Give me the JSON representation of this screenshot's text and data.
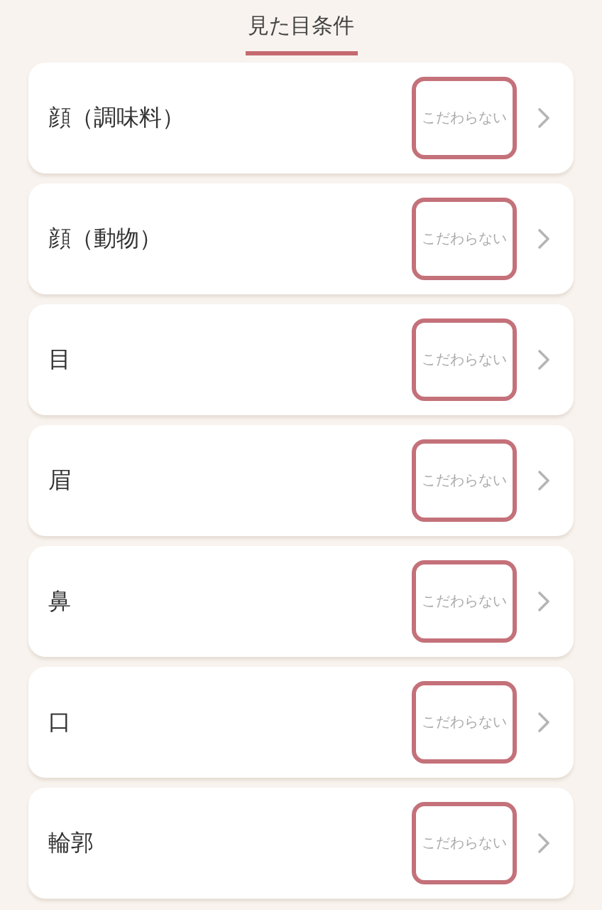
{
  "tabs": [
    {
      "label": "見た目条件",
      "selected": true
    }
  ],
  "conditions": [
    {
      "label": "顔（調味料）",
      "value": "こだわらない"
    },
    {
      "label": "顔（動物）",
      "value": "こだわらない"
    },
    {
      "label": "目",
      "value": "こだわらない"
    },
    {
      "label": "眉",
      "value": "こだわらない"
    },
    {
      "label": "鼻",
      "value": "こだわらない"
    },
    {
      "label": "口",
      "value": "こだわらない"
    },
    {
      "label": "輪郭",
      "value": "こだわらない"
    }
  ]
}
